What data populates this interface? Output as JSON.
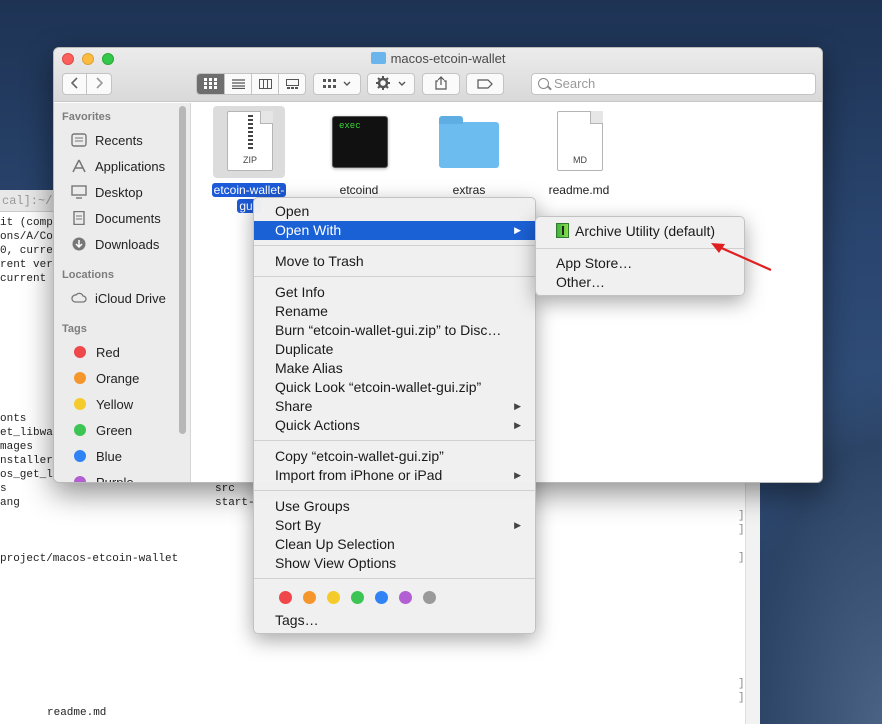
{
  "terminal": {
    "title": "cal]:~/De",
    "lines": [
      "it (comp",
      "ons/A/Co",
      "0, curre",
      "rent ver",
      "current "
    ],
    "lower_lines": [
      "onts",
      "et_libwa",
      "mages",
      "nstaller",
      "os_get_l",
      "s",
      "ang"
    ],
    "col2": [
      "src",
      "start-"
    ],
    "path_line": "project/macos-etcoin-wallet",
    "readme_line": "readme.md",
    "bracket": "]"
  },
  "finder": {
    "title": "macos-etcoin-wallet",
    "search_placeholder": "Search",
    "sidebar": {
      "favorites_label": "Favorites",
      "favorites": [
        {
          "label": "Recents",
          "icon": "recents-icon"
        },
        {
          "label": "Applications",
          "icon": "applications-icon"
        },
        {
          "label": "Desktop",
          "icon": "desktop-icon"
        },
        {
          "label": "Documents",
          "icon": "documents-icon"
        },
        {
          "label": "Downloads",
          "icon": "downloads-icon"
        }
      ],
      "locations_label": "Locations",
      "locations": [
        {
          "label": "iCloud Drive",
          "icon": "cloud-icon"
        }
      ],
      "tags_label": "Tags",
      "tags": [
        {
          "label": "Red",
          "color": "#f0484a"
        },
        {
          "label": "Orange",
          "color": "#f5962c"
        },
        {
          "label": "Yellow",
          "color": "#f5cb2c"
        },
        {
          "label": "Green",
          "color": "#3cc554"
        },
        {
          "label": "Blue",
          "color": "#2f83f5"
        },
        {
          "label": "Purple",
          "color": "#b15fd3"
        }
      ]
    },
    "files": [
      {
        "name_line1": "etcoin-wallet-",
        "name_line2": "gui.",
        "badge": "ZIP"
      },
      {
        "name": "etcoind",
        "badge": "exec"
      },
      {
        "name": "extras"
      },
      {
        "name": "readme.md",
        "badge": "MD"
      }
    ]
  },
  "context_menu": {
    "open": "Open",
    "open_with": "Open With",
    "move_to_trash": "Move to Trash",
    "get_info": "Get Info",
    "rename": "Rename",
    "burn": "Burn “etcoin-wallet-gui.zip” to Disc…",
    "duplicate": "Duplicate",
    "make_alias": "Make Alias",
    "quick_look": "Quick Look “etcoin-wallet-gui.zip”",
    "share": "Share",
    "quick_actions": "Quick Actions",
    "copy": "Copy “etcoin-wallet-gui.zip”",
    "import": "Import from iPhone or iPad",
    "use_groups": "Use Groups",
    "sort_by": "Sort By",
    "clean_up": "Clean Up Selection",
    "show_view_options": "Show View Options",
    "tags": "Tags…",
    "tag_colors": [
      "#f0484a",
      "#f5962c",
      "#f5cb2c",
      "#3cc554",
      "#2f83f5",
      "#b15fd3",
      "#9a9a9a"
    ],
    "arrow_glyph": "▶"
  },
  "submenu": {
    "archive_utility": "Archive Utility (default)",
    "app_store": "App Store…",
    "other": "Other…"
  },
  "colors": {
    "highlight": "#1b61d6",
    "annotation_arrow": "#e02020"
  }
}
